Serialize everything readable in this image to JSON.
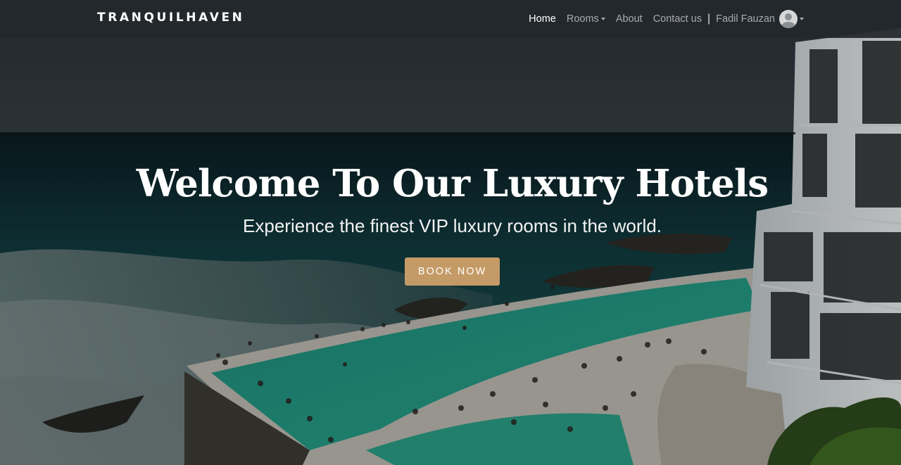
{
  "nav": {
    "brand": "TRANQUILHAVEN",
    "links": [
      {
        "label": "Home",
        "active": true
      },
      {
        "label": "Rooms",
        "dropdown": true
      },
      {
        "label": "About"
      },
      {
        "label": "Contact us"
      }
    ],
    "separator": "|",
    "user": {
      "name": "Fadil Fauzan",
      "avatar_icon": "user-avatar-icon"
    }
  },
  "hero": {
    "title": "Welcome To Our Luxury Hotels",
    "subtitle": "Experience the finest VIP luxury rooms in the world.",
    "cta_label": "BOOK NOW"
  },
  "colors": {
    "navbar_bg": "#23282c",
    "cta_bg": "#c49a66",
    "pool_water": "#1f8c7a",
    "ocean": "#0e3b40"
  }
}
